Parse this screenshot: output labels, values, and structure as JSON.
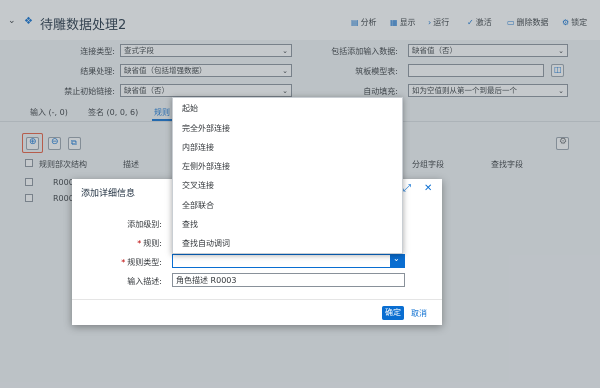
{
  "header": {
    "title": "待雕数据处理2",
    "toolbar": [
      "分析",
      "显示",
      "运行",
      "激活",
      "删除数据",
      "锁定"
    ]
  },
  "form": {
    "row1": {
      "label": "连接类型:",
      "value": "查式字段",
      "label2": "包括添加输入数据:",
      "value2": "缺省值（否）"
    },
    "row2": {
      "label": "结果处理:",
      "value": "缺省值（包括增强数据）",
      "label2": "筑板模型表:",
      "value2": ""
    },
    "row3": {
      "label": "禁止初始链接:",
      "value": "缺省值（否）",
      "label2": "自动填充:",
      "value2": "如为空值则从第一个到最后一个"
    }
  },
  "tabs": [
    "输入 (-, 0)",
    "签名 (0, 0, 6)",
    "规则"
  ],
  "grid": {
    "headers": [
      "规则部次结构",
      "描述",
      "分组字段",
      "查找字段"
    ],
    "rows": [
      "R000",
      "R000"
    ]
  },
  "dropdown": {
    "items": [
      "起始",
      "完全外部连接",
      "内部连接",
      "左侧外部连接",
      "交叉连接",
      "全部联合",
      "查找",
      "查找自动调词"
    ]
  },
  "dialog": {
    "title": "添加详细信息",
    "fields": {
      "level_label": "添加级别:",
      "rule_label": "规则:",
      "rule_type_label": "规则类型:",
      "desc_label": "输入描述:",
      "desc_value": "角色描述 R0003"
    },
    "ok_label": "确定",
    "cancel_label": "取消"
  },
  "colors": {
    "accent": "#0a6ed1",
    "required": "#bb0000",
    "highlight": "#e9593b"
  }
}
